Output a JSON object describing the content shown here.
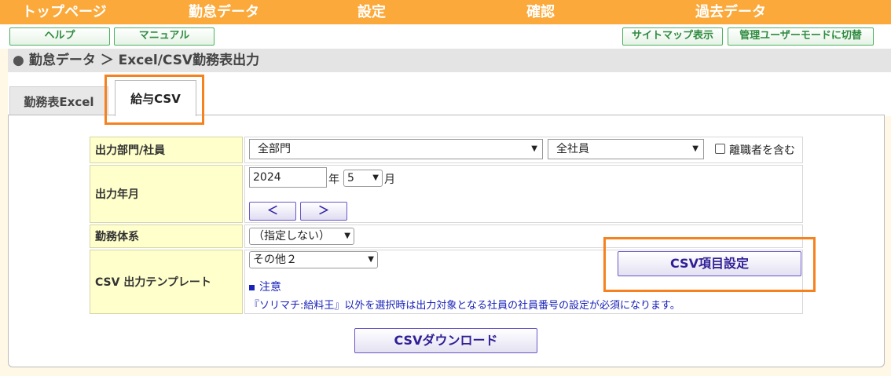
{
  "topnav": {
    "items": [
      "トップページ",
      "勤怠データ",
      "設定",
      "確認",
      "過去データ"
    ]
  },
  "subbar": {
    "help": "ヘルプ",
    "manual": "マニュアル",
    "sitemap": "サイトマップ表示",
    "admin_mode": "管理ユーザーモードに切替"
  },
  "breadcrumb": {
    "bullet": "●",
    "text": "勤怠データ ＞ Excel/CSV勤務表出力"
  },
  "tabs": {
    "excel": "勤務表Excel",
    "csv": "給与CSV",
    "active": "給与CSV"
  },
  "form": {
    "dept_label": "出力部門/社員",
    "dept_value": "全部門",
    "employee_value": "全社員",
    "retired_checkbox_label": "離職者を含む",
    "retired_checked": false,
    "yearmonth_label": "出力年月",
    "year_value": "2024",
    "year_unit": "年",
    "month_value": "5",
    "month_unit": "月",
    "prev_button": "＜",
    "next_button": "＞",
    "worksystem_label": "勤務体系",
    "worksystem_value": "（指定しない）",
    "template_label": "CSV 出力テンプレート",
    "template_value": "その他２",
    "csv_settings_button": "CSV項目設定",
    "note_title": "注意",
    "note_text": "『ソリマチ:給料王』以外を選択時は出力対象となる社員の社員番号の設定が必須になります。",
    "download_button": "CSVダウンロード"
  },
  "colors": {
    "topnav_bg": "#fba93a",
    "highlight": "#f5821f",
    "label_bg": "#ffffcc",
    "note_blue": "#1a23b8",
    "button_border": "#6b56c8"
  }
}
